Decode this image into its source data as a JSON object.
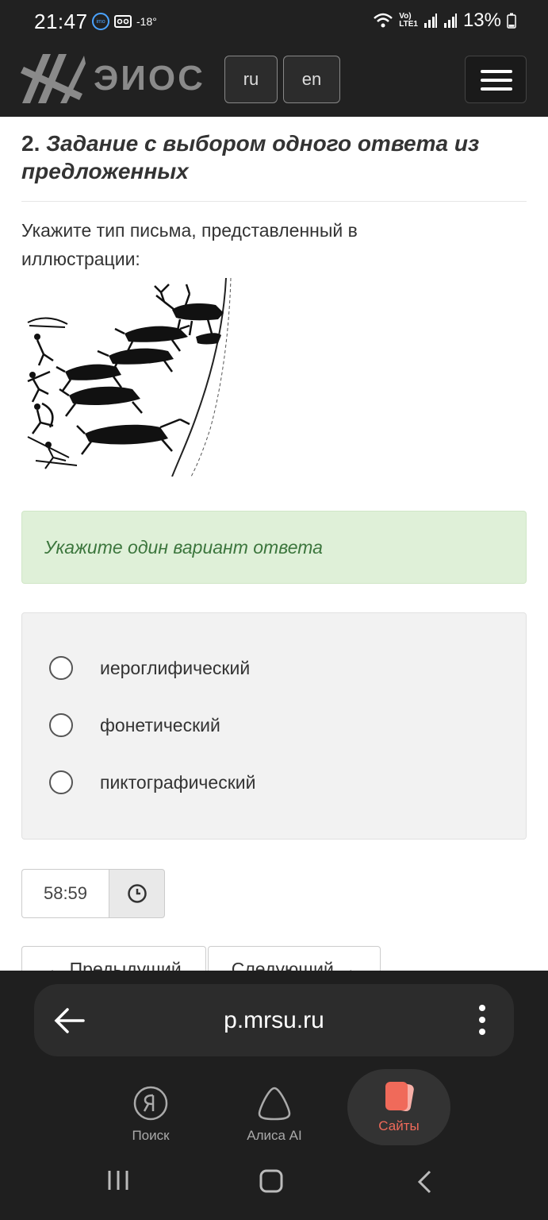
{
  "status_bar": {
    "time": "21:47",
    "left_icons": [
      "imo-icon",
      "voicemail-icon"
    ],
    "temperature": "-18°",
    "right_icons": [
      "wifi-icon",
      "volte-icon",
      "signal-icon",
      "signal-icon",
      "battery-icon"
    ],
    "volte_label": "Vo)\nLTE1",
    "battery": "13%"
  },
  "navbar": {
    "logo_text": "ЭИОС",
    "lang_ru": "ru",
    "lang_en": "en"
  },
  "question": {
    "number": "2.",
    "title": "Задание с выбором одного ответа из предложенных",
    "text": "Укажите тип письма, представленный в иллюстрации:",
    "hint": "Укажите один вариант ответа",
    "options": [
      "иероглифический",
      "фонетический",
      "пиктографический"
    ],
    "timer": "58:59",
    "prev_label": "← Предыдущий",
    "next_label": "Следующий →"
  },
  "browser": {
    "url": "p.mrsu.ru",
    "tabs": [
      {
        "label": "Поиск"
      },
      {
        "label": "Алиса AI"
      },
      {
        "label": "Сайты"
      }
    ]
  },
  "colors": {
    "accent_sites": "#f06a5a",
    "hint_bg": "#dff0d8",
    "hint_text": "#3c763d"
  }
}
